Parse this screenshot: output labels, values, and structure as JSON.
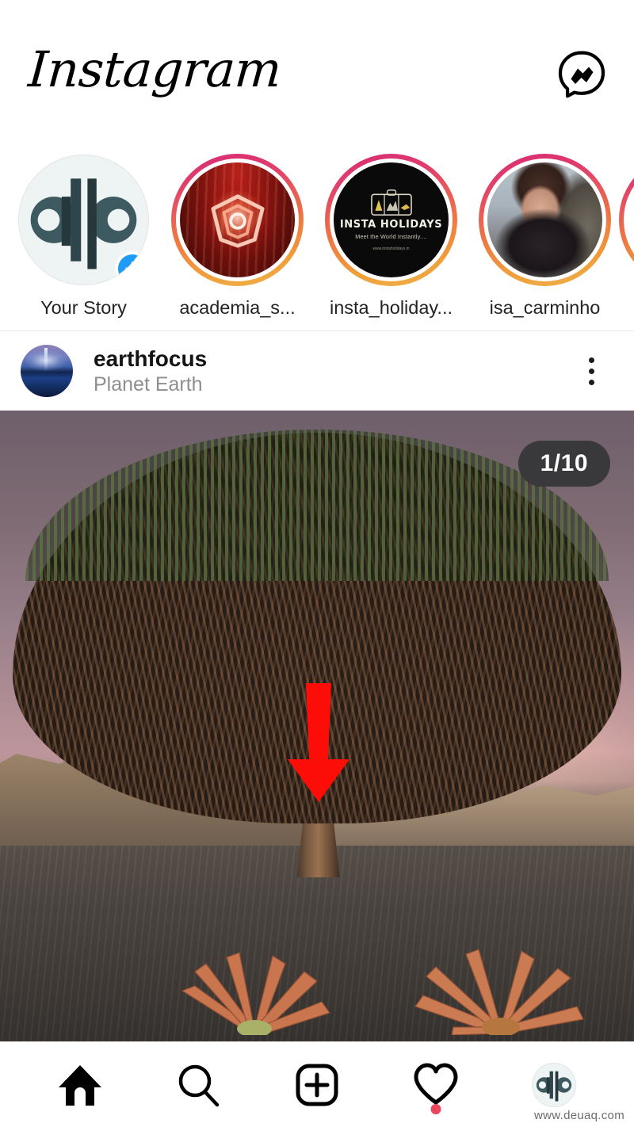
{
  "app": {
    "name": "Instagram",
    "logo_text": "Instagram"
  },
  "header": {
    "title": "Instagram",
    "messenger_icon": "messenger-icon"
  },
  "stories": {
    "items": [
      {
        "label": "Your Story",
        "has_ring": false,
        "has_add_badge": true,
        "avatar_type": "alp-logo"
      },
      {
        "label": "academia_s...",
        "has_ring": true,
        "has_add_badge": false,
        "avatar_type": "red-emblem"
      },
      {
        "label": "insta_holiday...",
        "has_ring": true,
        "has_add_badge": false,
        "avatar_type": "insta-holidays-logo",
        "avatar_text": {
          "title": "INSTA HOLIDAYS",
          "tagline": "Meet the World Instantly....",
          "url": "www.instaholidays.in"
        }
      },
      {
        "label": "isa_carminho",
        "has_ring": true,
        "has_add_badge": false,
        "avatar_type": "portrait-photo"
      }
    ]
  },
  "post": {
    "username": "earthfocus",
    "location": "Planet Earth",
    "menu_icon": "more-options-icon",
    "carousel_counter": "1/10"
  },
  "annotation": {
    "arrow_color": "#fc0d08",
    "points_to": "create-button"
  },
  "bottom_nav": {
    "items": [
      {
        "name": "home",
        "icon": "home-icon",
        "active": true,
        "badge": false
      },
      {
        "name": "search",
        "icon": "search-icon",
        "active": false,
        "badge": false
      },
      {
        "name": "create",
        "icon": "plus-square-icon",
        "active": false,
        "badge": false
      },
      {
        "name": "activity",
        "icon": "heart-icon",
        "active": false,
        "badge": true
      },
      {
        "name": "profile",
        "icon": "profile-avatar-icon",
        "active": false,
        "badge": false
      }
    ]
  },
  "watermark": {
    "text": "www.deuaq.com"
  },
  "colors": {
    "accent_blue": "#1c9cf6",
    "story_ring_start": "#d62976",
    "story_ring_end": "#eeb04a",
    "notification_red": "#e8455f",
    "arrow_red": "#fc0d08",
    "counter_bg": "#39393b",
    "secondary_text": "#8e8e8e"
  }
}
